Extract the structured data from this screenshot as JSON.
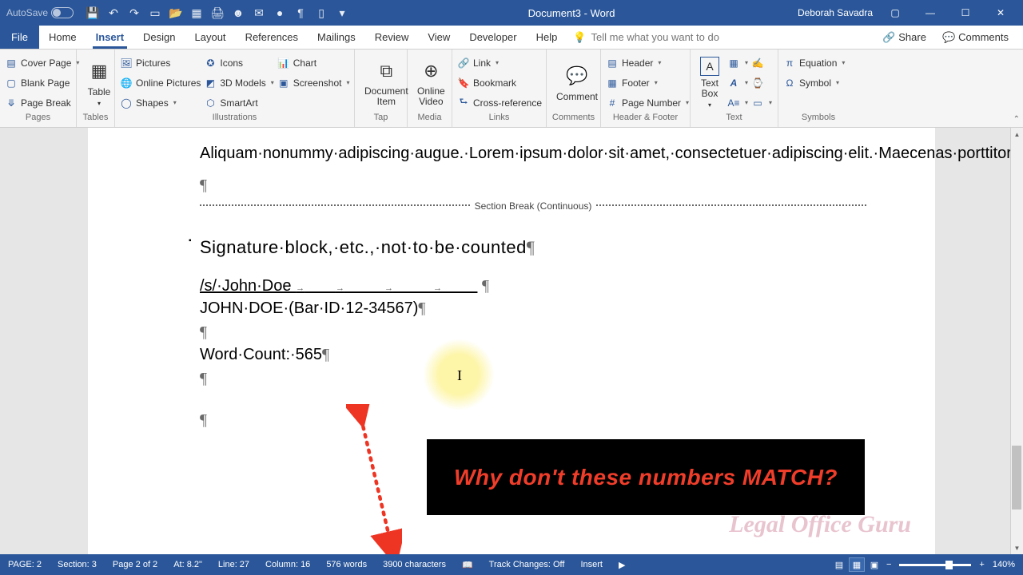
{
  "titlebar": {
    "autosave_label": "AutoSave",
    "doc_title": "Document3 - Word",
    "user": "Deborah Savadra"
  },
  "menu": {
    "file": "File",
    "tabs": [
      "Home",
      "Insert",
      "Design",
      "Layout",
      "References",
      "Mailings",
      "Review",
      "View",
      "Developer",
      "Help"
    ],
    "tellme": "Tell me what you want to do",
    "share": "Share",
    "comments": "Comments"
  },
  "ribbon": {
    "pages": {
      "cover": "Cover Page",
      "blank": "Blank Page",
      "brk": "Page Break",
      "label": "Pages"
    },
    "table_label": "Table",
    "tables": "Tables",
    "illus": {
      "pictures": "Pictures",
      "online": "Online Pictures",
      "shapes": "Shapes",
      "icons": "Icons",
      "models": "3D Models",
      "smart": "SmartArt",
      "chart": "Chart",
      "screen": "Screenshot",
      "label": "Illustrations"
    },
    "tap": {
      "big": "Document\nItem",
      "label": "Tap"
    },
    "media": {
      "big": "Online\nVideo",
      "label": "Media"
    },
    "links": {
      "link": "Link",
      "bookmark": "Bookmark",
      "xref": "Cross-reference",
      "label": "Links"
    },
    "comments": {
      "big": "Comment",
      "label": "Comments"
    },
    "hf": {
      "header": "Header",
      "footer": "Footer",
      "pagenum": "Page Number",
      "label": "Header & Footer"
    },
    "text": {
      "box": "Text\nBox",
      "label": "Text"
    },
    "symbols": {
      "eq": "Equation",
      "sym": "Symbol",
      "label": "Symbols"
    }
  },
  "document": {
    "body": "Aliquam·nonummy·adipiscing·augue.·Lorem·ipsum·dolor·sit·amet,·consectetuer·adipiscing·elit.·Maecenas·porttitor·congue·massa.·Fusce·posuere,·magna·sed·pulvinar·ultricies,·purus·lectus·malesuada·libero,·sit·amet·commodo·magna·eros·quis·urna.·Nunc·viverra·imperdiet·enim.",
    "section_break": "Section Break (Continuous)",
    "heading": "Signature·block,·etc.,·not·to·be·counted",
    "sig": "/s/·John·Doe",
    "barid": "JOHN·DOE·(Bar·ID·12-34567)",
    "wordcount": "Word·Count:·565"
  },
  "annotation": {
    "text": "Why don't these numbers MATCH?"
  },
  "watermark": "Legal Office Guru",
  "statusbar": {
    "page": "PAGE: 2",
    "section": "Section: 3",
    "pof": "Page 2 of 2",
    "at": "At: 8.2\"",
    "line": "Line: 27",
    "col": "Column: 16",
    "words": "576 words",
    "chars": "3900 characters",
    "track": "Track Changes: Off",
    "insert": "Insert",
    "zoom": "140%"
  }
}
